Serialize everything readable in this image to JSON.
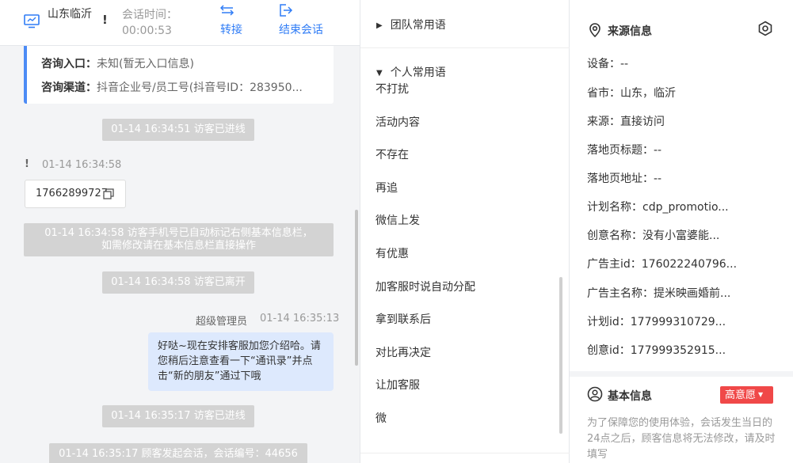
{
  "header": {
    "visitor_name": "山东临沂",
    "warn": "!",
    "session_label": "会话时间：",
    "session_time": "00:00:53",
    "transfer_label": "转接",
    "end_label": "结束会话"
  },
  "info_card": {
    "entry_label": "咨询入口：",
    "entry_value": "未知(暂无入口信息)",
    "channel_label": "咨询渠道：",
    "channel_value": "抖音企业号/员工号(抖音号ID：283950..."
  },
  "messages": {
    "sys1": "01-14 16:34:51 访客已进线",
    "visitor_warn": "!",
    "visitor_time": "01-14 16:34:58",
    "phone": "17662899727",
    "sys2_line1": "01-14 16:34:58 访客手机号已自动标记右侧基本信息栏，",
    "sys2_line2": "如需修改请在基本信息栏直接操作",
    "sys3": "01-14 16:34:58 访客已离开",
    "agent_name": "超级管理员",
    "agent_time": "01-14 16:35:13",
    "agent_msg": "好哒~现在安排客服加您介绍哈。请您稍后注意查看一下“通讯录”并点击“新的朋友”通过下哦",
    "sys4": "01-14 16:35:17 访客已进线",
    "sys5": "01-14 16:35:17 顾客发起会话，会话编号：44656"
  },
  "phrases": {
    "team_group": "团队常用语",
    "personal_group": "个人常用语",
    "items": [
      "不打扰",
      "活动内容",
      "不存在",
      "再追",
      "微信上发",
      "有优惠",
      "加客服时说自动分配",
      "拿到联系后",
      "对比再决定",
      "让加客服",
      "微"
    ]
  },
  "source_info": {
    "title": "来源信息",
    "fields": [
      "设备：--",
      "省市：山东，临沂",
      "来源：直接访问",
      "落地页标题：--",
      "落地页地址：--",
      "计划名称：cdp_promotio...",
      "创意名称：没有小富婆能...",
      "广告主id：176022240796...",
      "广告主名称：提米映画婚前...",
      "计划id：177999310729...",
      "创意id：177999352915..."
    ]
  },
  "basic_info": {
    "title": "基本信息",
    "intent": "高意愿",
    "notice": "为了保障您的使用体验，会话发生当日的24点之后，顾客信息将无法修改，请及时填写"
  },
  "colors": {
    "accent": "#2f7cf6",
    "bubble": "#dde9fd",
    "pill": "#d3d3d3",
    "tag": "#f04848"
  }
}
